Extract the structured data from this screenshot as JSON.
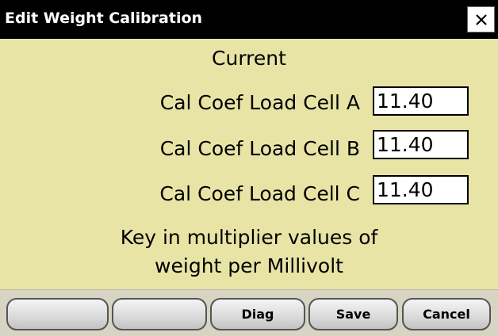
{
  "window": {
    "title": "Edit Weight Calibration",
    "close_icon": "close-icon"
  },
  "content": {
    "heading": "Current",
    "load_cells": [
      {
        "label": "Cal Coef Load Cell A",
        "value": "11.40"
      },
      {
        "label": "Cal Coef Load Cell B",
        "value": "11.40"
      },
      {
        "label": "Cal Coef Load Cell C",
        "value": "11.40"
      }
    ],
    "note_line1": "Key in multiplier values of",
    "note_line2": "weight per Millivolt"
  },
  "buttons": {
    "soft1": "",
    "soft2": "",
    "diag": "Diag",
    "save": "Save",
    "cancel": "Cancel"
  },
  "colors": {
    "panel_background": "#e8e4a6",
    "titlebar_background": "#000000",
    "button_bar_background": "#d7d4c3"
  }
}
